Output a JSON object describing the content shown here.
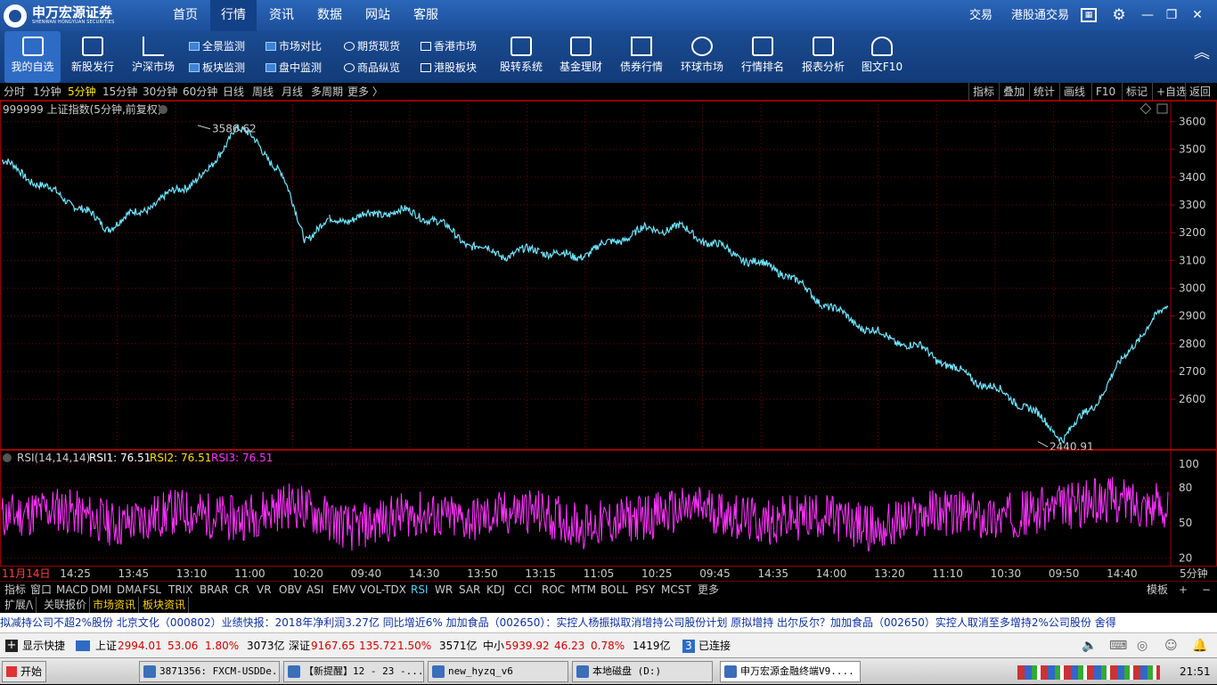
{
  "app": {
    "logo_cn": "申万宏源证券",
    "logo_en": "SHENWAN HONGYUAN SECURITIES"
  },
  "top_tabs": [
    {
      "label": "首页",
      "active": false
    },
    {
      "label": "行情",
      "active": true
    },
    {
      "label": "资讯",
      "active": false
    },
    {
      "label": "数据",
      "active": false
    },
    {
      "label": "网站",
      "active": false
    },
    {
      "label": "客服",
      "active": false
    }
  ],
  "top_right": {
    "trade": "交易",
    "hk_trade": "港股通交易"
  },
  "toolbar": {
    "big": [
      "我的自选",
      "新股发行",
      "沪深市场",
      "股转系统",
      "基金理财",
      "债券行情",
      "环球市场",
      "行情排名",
      "报表分析",
      "图文F10"
    ],
    "small": [
      [
        "全景监测",
        "板块监测"
      ],
      [
        "市场对比",
        "盘中监测"
      ],
      [
        "期货现货",
        "商品纵览"
      ],
      [
        "香港市场",
        "港股板块"
      ]
    ]
  },
  "periods": [
    "分时",
    "1分钟",
    "5分钟",
    "15分钟",
    "30分钟",
    "60分钟",
    "日线",
    "周线",
    "月线",
    "多周期",
    "更多 〉"
  ],
  "active_period": "5分钟",
  "right_tools": [
    "指标",
    "叠加",
    "统计",
    "画线",
    "F10",
    "标记",
    "+自选",
    "返回"
  ],
  "chart_title": "999999 上证指数(5分钟,前复权)",
  "rsi_header": {
    "name": "RSI(14,14,14)",
    "rsi1": "RSI1: 76.51",
    "rsi2": "RSI2: 76.51",
    "rsi3": "RSI3: 76.51"
  },
  "period_right": "5分钟",
  "indicators": [
    "指标",
    "窗口",
    "MACD",
    "DMI",
    "DMA",
    "FSL",
    "TRIX",
    "BRAR",
    "CR",
    "VR",
    "OBV",
    "ASI",
    "EMV",
    "VOL-TDX",
    "RSI",
    "WR",
    "SAR",
    "KDJ",
    "CCI",
    "ROC",
    "MTM",
    "BOLL",
    "PSY",
    "MCST",
    "更多"
  ],
  "active_indicator": "RSI",
  "indbar_right": [
    "模板",
    "+",
    "−"
  ],
  "bottom_tabs": [
    "扩展/\\",
    "关联报价",
    "市场资讯",
    "板块资讯"
  ],
  "ticker": "拟减持公司不超2%股份      北京文化（000802）业绩快报：2018年净利润3.27亿  同比增近6%        加加食品（002650）：实控人杨振拟取消增持公司股份计划  原拟增持        出尔反尔？加加食品（002650）实控人取消至多增持2%公司股份      舍得",
  "status": {
    "shortcut": "显示快捷",
    "sh": {
      "label": "上证",
      "price": "2994.01",
      "chg": "53.06",
      "pct": "1.80%",
      "amt": "3073亿"
    },
    "sz": {
      "label": "深证",
      "price": "9167.65",
      "chg": "135.72",
      "pct": "1.50%",
      "amt": "3571亿"
    },
    "zx": {
      "label": "中小",
      "price": "5939.92",
      "chg": "46.23",
      "pct": "0.78%",
      "amt": "1419亿"
    },
    "conn_num": "3",
    "conn": "已连接"
  },
  "taskbar": {
    "start": "开始",
    "tasks": [
      "3871356: FXCM-USDDe...",
      "【新提醒】12 - 23 -...",
      "new_hyzq_v6",
      "本地磁盘 (D:)",
      "申万宏源金融终端V9...."
    ],
    "clock": "21:51"
  },
  "colors": {
    "price_line": "#6fe6ff",
    "rsi": "#ff33ff",
    "grid": "#7a0000",
    "axis": "#a00000"
  },
  "chart_data": [
    {
      "type": "line",
      "title": "999999 上证指数(5分钟,前复权)",
      "yticks": [
        3600,
        3500,
        3400,
        3300,
        3200,
        3100,
        3000,
        2900,
        2800,
        2700,
        2600
      ],
      "ylim": [
        2440,
        3650
      ],
      "x_labels": [
        "11月14日",
        "14:25",
        "13:45",
        "13:10",
        "11:00",
        "10:20",
        "09:40",
        "14:30",
        "13:50",
        "13:15",
        "11:05",
        "10:25",
        "09:45",
        "14:35",
        "14:00",
        "13:20",
        "11:10",
        "10:30",
        "09:50",
        "14:40"
      ],
      "annotations": [
        {
          "label": "3586.62",
          "value": 3586.62
        },
        {
          "label": "2440.91",
          "value": 2440.91
        }
      ],
      "series": [
        {
          "x": [
            0,
            3,
            6,
            9,
            12,
            15,
            18,
            20,
            22,
            24,
            26,
            28,
            31,
            34,
            37,
            40,
            43,
            46,
            49,
            52,
            55,
            58,
            61,
            64,
            67,
            70,
            73,
            76,
            79,
            82,
            85,
            88,
            91,
            94,
            97,
            100
          ],
          "y": [
            3460,
            3380,
            3310,
            3220,
            3280,
            3350,
            3430,
            3586,
            3520,
            3410,
            3180,
            3240,
            3260,
            3280,
            3250,
            3160,
            3120,
            3140,
            3110,
            3160,
            3210,
            3220,
            3160,
            3100,
            3060,
            2960,
            2880,
            2820,
            2780,
            2700,
            2640,
            2570,
            2460,
            2600,
            2800,
            2940
          ]
        }
      ]
    },
    {
      "type": "line",
      "title": "RSI(14,14,14)",
      "yticks": [
        100,
        80,
        50,
        20
      ],
      "ylim": [
        15,
        100
      ],
      "series": [
        {
          "name": "RSI1",
          "x": [
            0,
            5,
            10,
            15,
            20,
            25,
            30,
            35,
            40,
            45,
            50,
            55,
            60,
            65,
            70,
            75,
            80,
            85,
            90,
            95,
            100
          ],
          "y": [
            55,
            62,
            48,
            60,
            53,
            66,
            45,
            58,
            52,
            61,
            47,
            55,
            63,
            50,
            57,
            44,
            60,
            54,
            62,
            70,
            64
          ]
        }
      ]
    }
  ]
}
